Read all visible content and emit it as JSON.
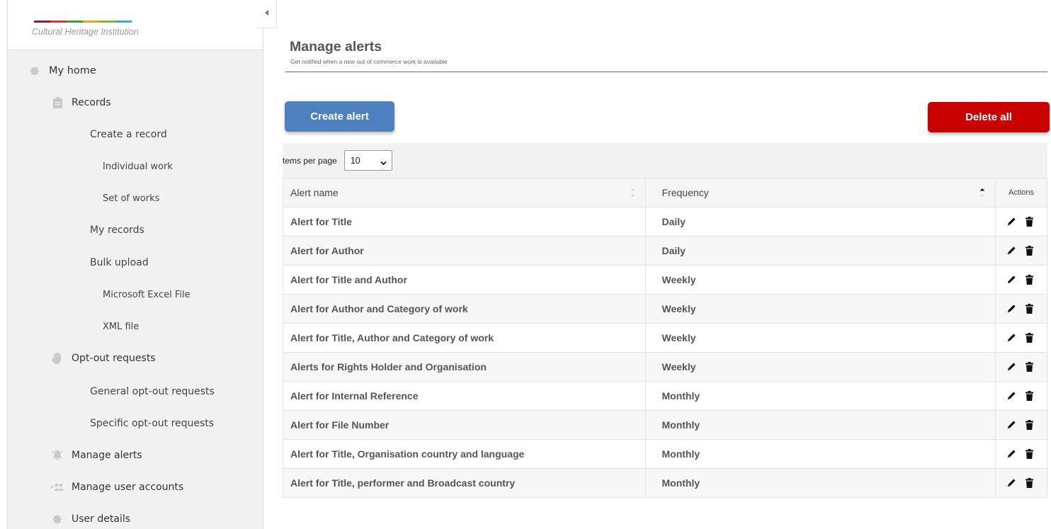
{
  "sidebar": {
    "institution": "Cultural Heritage Institution",
    "stripe_colors": [
      "#8b1c3c",
      "#d63a2f",
      "#3a9f3a",
      "#f0a020",
      "#7fb838",
      "#3ea8d8"
    ],
    "collapse_icon": "caret-left-icon",
    "items": [
      {
        "label": "My home",
        "icon": "gear-icon",
        "level": 0
      },
      {
        "label": "Records",
        "icon": "clipboard-icon",
        "level": 1
      },
      {
        "label": "Create a record",
        "level": 2
      },
      {
        "label": "Individual work",
        "level": 3
      },
      {
        "label": "Set of works",
        "level": 3
      },
      {
        "label": "My records",
        "level": 2
      },
      {
        "label": "Bulk upload",
        "level": 2
      },
      {
        "label": "Microsoft Excel File",
        "level": 3
      },
      {
        "label": "XML file",
        "level": 3
      },
      {
        "label": "Opt-out requests",
        "icon": "hand-icon",
        "level": 1
      },
      {
        "label": "General opt-out requests",
        "level": 2
      },
      {
        "label": "Specific opt-out requests",
        "level": 2
      },
      {
        "label": "Manage alerts",
        "icon": "bell-icon",
        "level": 1
      },
      {
        "label": "Manage user accounts",
        "icon": "add-users-icon",
        "level": 1
      },
      {
        "label": "User details",
        "icon": "gear-icon",
        "level": 1
      }
    ]
  },
  "header": {
    "title": "Manage alerts",
    "subtitle": "Get notified when a new out of commerce work  is available"
  },
  "buttons": {
    "create": "Create alert",
    "delete_all": "Delete all"
  },
  "colors": {
    "create_button": "#4e7fbf",
    "delete_button": "#c90000"
  },
  "table": {
    "items_per_page_label": "tems per page",
    "items_per_page_value": "10",
    "columns": [
      "Alert name",
      "Frequency",
      "Actions"
    ],
    "action_icons": [
      "pencil-icon",
      "trash-icon"
    ],
    "rows": [
      {
        "name": "Alert for Title",
        "frequency": "Daily"
      },
      {
        "name": "Alert for Author",
        "frequency": "Daily"
      },
      {
        "name": "Alert for Title and Author",
        "frequency": "Weekly"
      },
      {
        "name": "Alert for Author and Category of work",
        "frequency": "Weekly"
      },
      {
        "name": "Alert for Title, Author and Category of work",
        "frequency": "Weekly"
      },
      {
        "name": "Alerts for Rights Holder and Organisation",
        "frequency": "Weekly"
      },
      {
        "name": "Alert for Internal Reference",
        "frequency": "Monthly"
      },
      {
        "name": "Alert for File Number",
        "frequency": "Monthly"
      },
      {
        "name": "Alert for Title, Organisation country and language",
        "frequency": "Monthly"
      },
      {
        "name": "Alert for Title, performer and Broadcast country",
        "frequency": "Monthly"
      }
    ]
  }
}
